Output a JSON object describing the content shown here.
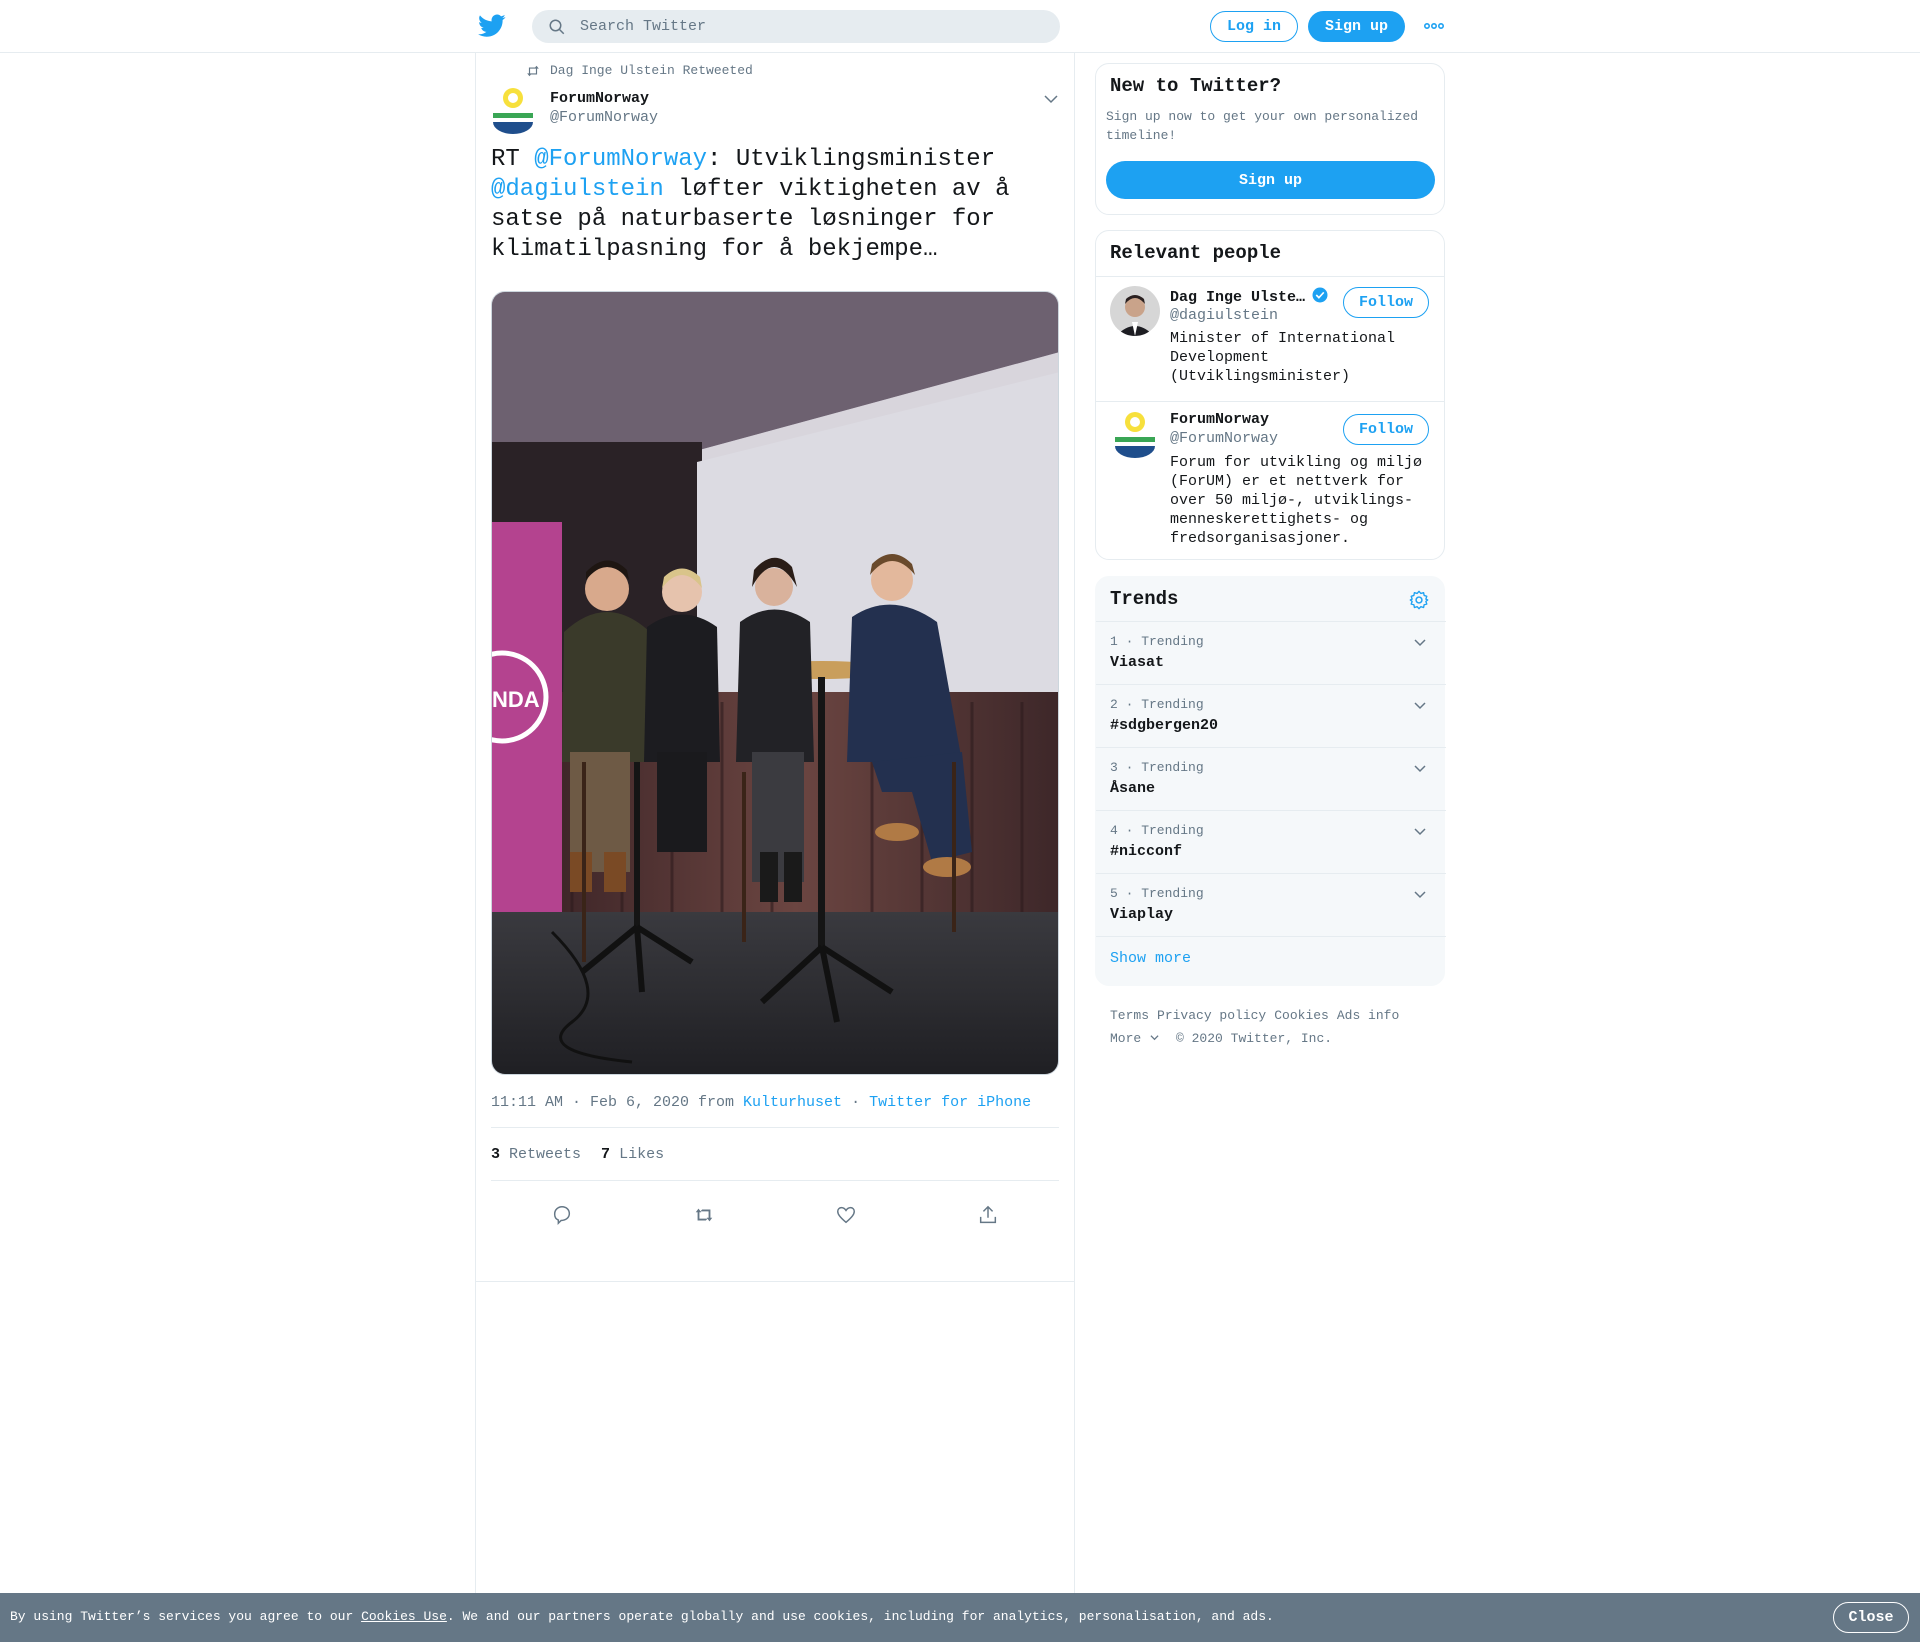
{
  "header": {
    "search_placeholder": "Search Twitter",
    "login_label": "Log in",
    "signup_label": "Sign up",
    "brand_color": "#1da1f2"
  },
  "tweet": {
    "retweeted_by": "Dag Inge Ulstein Retweeted",
    "author_name": "ForumNorway",
    "author_handle": "@ForumNorway",
    "text_parts": {
      "p1": "RT ",
      "m1": "@ForumNorway",
      "p2": ": Utviklingsminister ",
      "m2": "@dagiulstein",
      "p3": " løfter viktigheten av å satse på naturbaserte løsninger for klimatilpasning for å bekjempe…"
    },
    "time": "11:11 AM · Feb 6, 2020 from ",
    "place": "Kulturhuset",
    "separator": " · ",
    "source": "Twitter for iPhone",
    "retweets_count": "3",
    "retweets_label": "Retweets",
    "likes_count": "7",
    "likes_label": "Likes",
    "photo_sign_text": "NDA"
  },
  "new_to_twitter": {
    "title": "New to Twitter?",
    "desc": "Sign up now to get your own personalized timeline!",
    "button": "Sign up"
  },
  "relevant_people": {
    "title": "Relevant people",
    "people": [
      {
        "name": "Dag Inge Ulste…",
        "handle": "@dagiulstein",
        "bio": "Minister of International Development (Utviklingsminister)",
        "follow": "Follow",
        "verified": true
      },
      {
        "name": "ForumNorway",
        "handle": "@ForumNorway",
        "bio": "Forum for utvikling og miljø (ForUM) er et nettverk for over 50 miljø-, utviklings- menneskerettighets- og fredsorganisasjoner.",
        "follow": "Follow",
        "verified": false
      }
    ]
  },
  "trends": {
    "title": "Trends",
    "items": [
      {
        "rank": "1 · Trending",
        "name": "Viasat"
      },
      {
        "rank": "2 · Trending",
        "name": "#sdgbergen20"
      },
      {
        "rank": "3 · Trending",
        "name": "Åsane"
      },
      {
        "rank": "4 · Trending",
        "name": "#nicconf"
      },
      {
        "rank": "5 · Trending",
        "name": "Viaplay"
      }
    ],
    "show_more": "Show more"
  },
  "footer": {
    "terms": "Terms",
    "privacy": "Privacy policy",
    "cookies": "Cookies",
    "ads": "Ads info",
    "more": "More",
    "copyright": "© 2020 Twitter, Inc."
  },
  "cookie_banner": {
    "text_before": "By using Twitter’s services you agree to our ",
    "link": "Cookies Use",
    "text_after": ". We and our partners operate globally and use cookies, including for analytics, personalisation, and ads.",
    "close": "Close"
  }
}
